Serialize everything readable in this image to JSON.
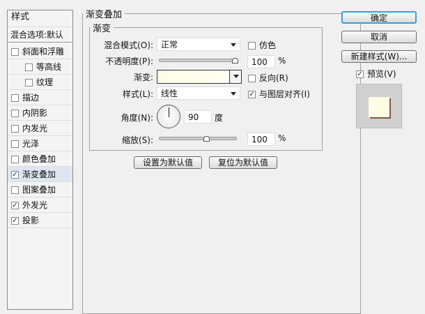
{
  "sidebar": {
    "header": "样式",
    "blend": "混合选项:默认",
    "items": [
      {
        "label": "斜面和浮雕",
        "checked": false
      },
      {
        "label": "等高线",
        "checked": false
      },
      {
        "label": "纹理",
        "checked": false
      },
      {
        "label": "描边",
        "checked": false
      },
      {
        "label": "内阴影",
        "checked": false
      },
      {
        "label": "内发光",
        "checked": false
      },
      {
        "label": "光泽",
        "checked": false
      },
      {
        "label": "颜色叠加",
        "checked": false
      },
      {
        "label": "渐变叠加",
        "checked": true
      },
      {
        "label": "图案叠加",
        "checked": false
      },
      {
        "label": "外发光",
        "checked": true
      },
      {
        "label": "投影",
        "checked": true
      }
    ]
  },
  "panel": {
    "title": "渐变叠加",
    "group": "渐变",
    "blend_label": "混合模式(O):",
    "blend_value": "正常",
    "dither_label": "仿色",
    "opacity_label": "不透明度(P):",
    "opacity_value": "100",
    "pct": "%",
    "gradient_label": "渐变:",
    "reverse_label": "反向(R)",
    "style_label": "样式(L):",
    "style_value": "线性",
    "align_label": "与图层对齐(I)",
    "angle_label": "角度(N):",
    "angle_value": "90",
    "degree": "度",
    "scale_label": "缩放(S):",
    "scale_value": "100",
    "set_default": "设置为默认值",
    "reset_default": "复位为默认值"
  },
  "buttons": {
    "ok": "确定",
    "cancel": "取消",
    "new_style": "新建样式(W)...",
    "preview": "预览(V)"
  },
  "gradient_color": "#fdfde6"
}
